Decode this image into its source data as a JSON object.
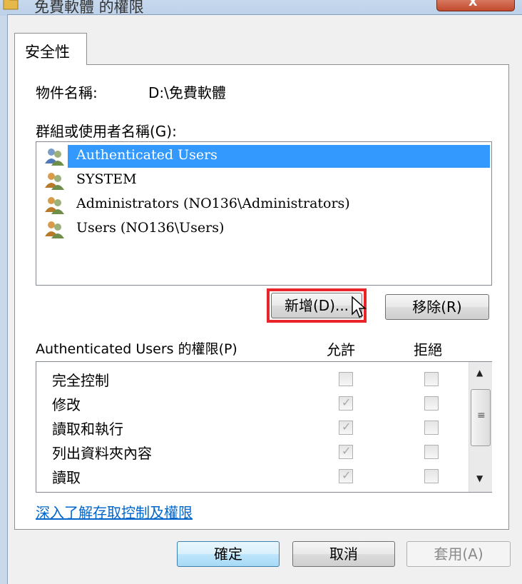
{
  "window": {
    "title": "免費軟體 的權限",
    "close_label": "X"
  },
  "tab": {
    "label": "安全性"
  },
  "object": {
    "label": "物件名稱:",
    "value": "D:\\免費軟體"
  },
  "groups": {
    "label": "群組或使用者名稱(G):",
    "items": [
      {
        "name": "Authenticated Users",
        "selected": true
      },
      {
        "name": "SYSTEM",
        "selected": false
      },
      {
        "name": "Administrators (NO136\\Administrators)",
        "selected": false
      },
      {
        "name": "Users (NO136\\Users)",
        "selected": false
      }
    ]
  },
  "buttons": {
    "add": "新增(D)...",
    "remove": "移除(R)"
  },
  "permissions": {
    "label": "Authenticated Users 的權限(P)",
    "allow_header": "允許",
    "deny_header": "拒絕",
    "rows": [
      {
        "name": "完全控制",
        "allow": false,
        "deny": false,
        "allow_inherited": false
      },
      {
        "name": "修改",
        "allow": true,
        "deny": false,
        "allow_inherited": true
      },
      {
        "name": "讀取和執行",
        "allow": true,
        "deny": false,
        "allow_inherited": true
      },
      {
        "name": "列出資料夾內容",
        "allow": true,
        "deny": false,
        "allow_inherited": true
      },
      {
        "name": "讀取",
        "allow": true,
        "deny": false,
        "allow_inherited": true
      }
    ]
  },
  "help_link": "深入了解存取控制及權限",
  "footer": {
    "ok": "確定",
    "cancel": "取消",
    "apply": "套用(A)"
  },
  "colors": {
    "selection": "#3399ff",
    "highlight_box": "#e8252a",
    "link": "#0066cc"
  }
}
